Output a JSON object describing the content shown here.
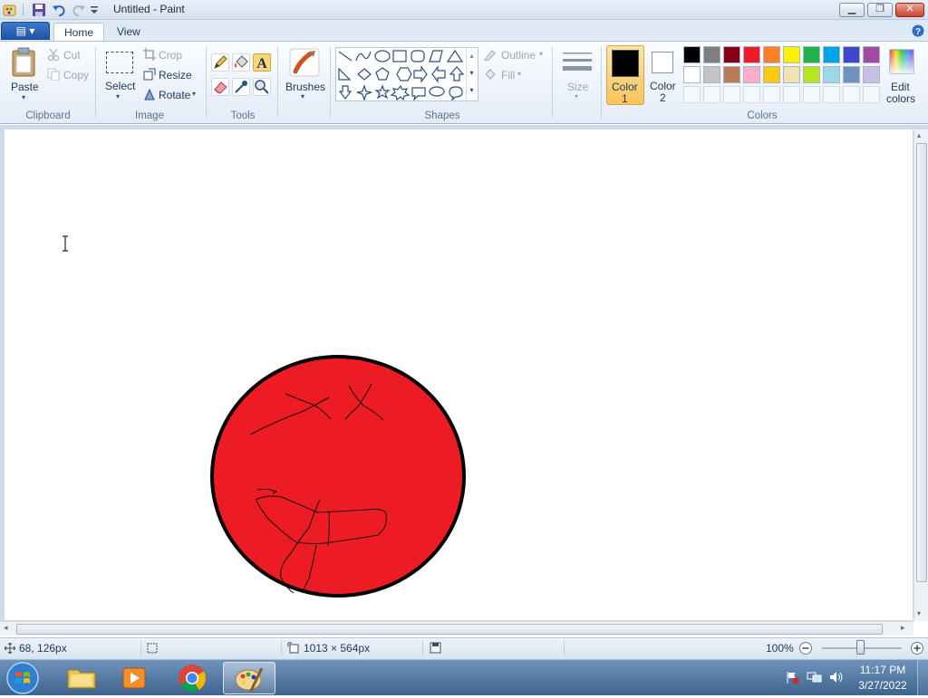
{
  "window": {
    "title": "Untitled - Paint",
    "tabs": [
      {
        "label": "Home"
      },
      {
        "label": "View"
      }
    ]
  },
  "clipboard": {
    "paste": "Paste",
    "cut": "Cut",
    "copy": "Copy",
    "group": "Clipboard"
  },
  "image": {
    "select": "Select",
    "crop": "Crop",
    "resize": "Resize",
    "rotate": "Rotate",
    "group": "Image"
  },
  "tools": {
    "group": "Tools",
    "brushes": "Brushes"
  },
  "shapes": {
    "group": "Shapes",
    "outline": "Outline",
    "fill": "Fill",
    "size": "Size"
  },
  "colors": {
    "group": "Colors",
    "color1_label_a": "Color",
    "color1_label_b": "1",
    "color2_label_a": "Color",
    "color2_label_b": "2",
    "edit_a": "Edit",
    "edit_b": "colors",
    "color1": "#000000",
    "color2": "#ffffff",
    "row1": [
      "#000000",
      "#7f7f7f",
      "#880015",
      "#ed1c24",
      "#ff7f27",
      "#fff200",
      "#22b14c",
      "#00a2e8",
      "#3f48cc",
      "#a349a4"
    ],
    "row2": [
      "#ffffff",
      "#c3c3c3",
      "#b97a57",
      "#ffaec9",
      "#ffc90e",
      "#efe4b0",
      "#b5e61d",
      "#99d9ea",
      "#7092be",
      "#c8bfe7"
    ]
  },
  "canvas": {
    "circle_fill": "#ed1c24",
    "circle_stroke": "#000000"
  },
  "status": {
    "cursor_pos": "68, 126px",
    "canvas_size": "1013 × 564px",
    "zoom": "100%"
  },
  "taskbar": {
    "time": "11:17 PM",
    "date": "3/27/2022"
  }
}
